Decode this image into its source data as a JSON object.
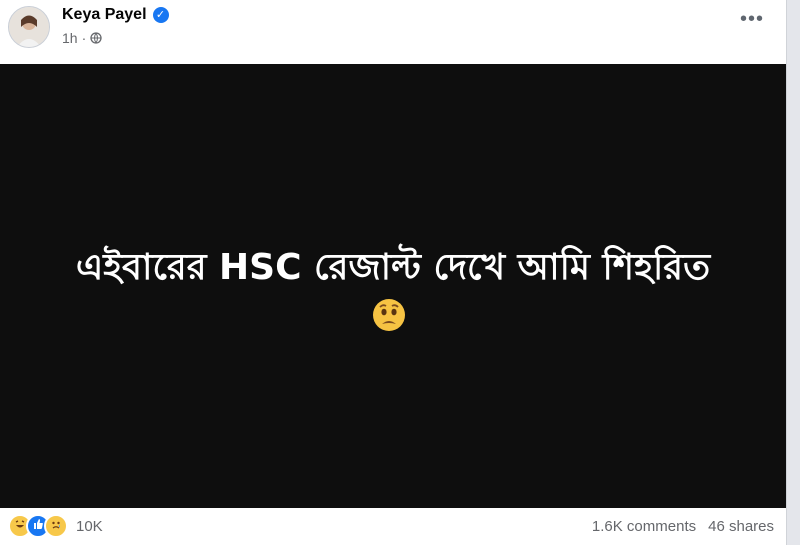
{
  "post": {
    "author": "Keya Payel",
    "time": "1h",
    "meta_separator": "·",
    "more_label": "•••"
  },
  "media": {
    "caption": "এইবারের HSC রেজাল্ট দেখে আমি শিহরিত",
    "emoji_icon": "worried-face-icon"
  },
  "footer": {
    "reaction_icons": [
      "haha-icon",
      "like-icon",
      "sad-icon"
    ],
    "reaction_count": "10K",
    "comments": "1.6K comments",
    "shares": "46 shares"
  },
  "colors": {
    "brand_blue": "#1877f2",
    "media_background": "#0e0e0e",
    "secondary_text": "#65676b"
  }
}
